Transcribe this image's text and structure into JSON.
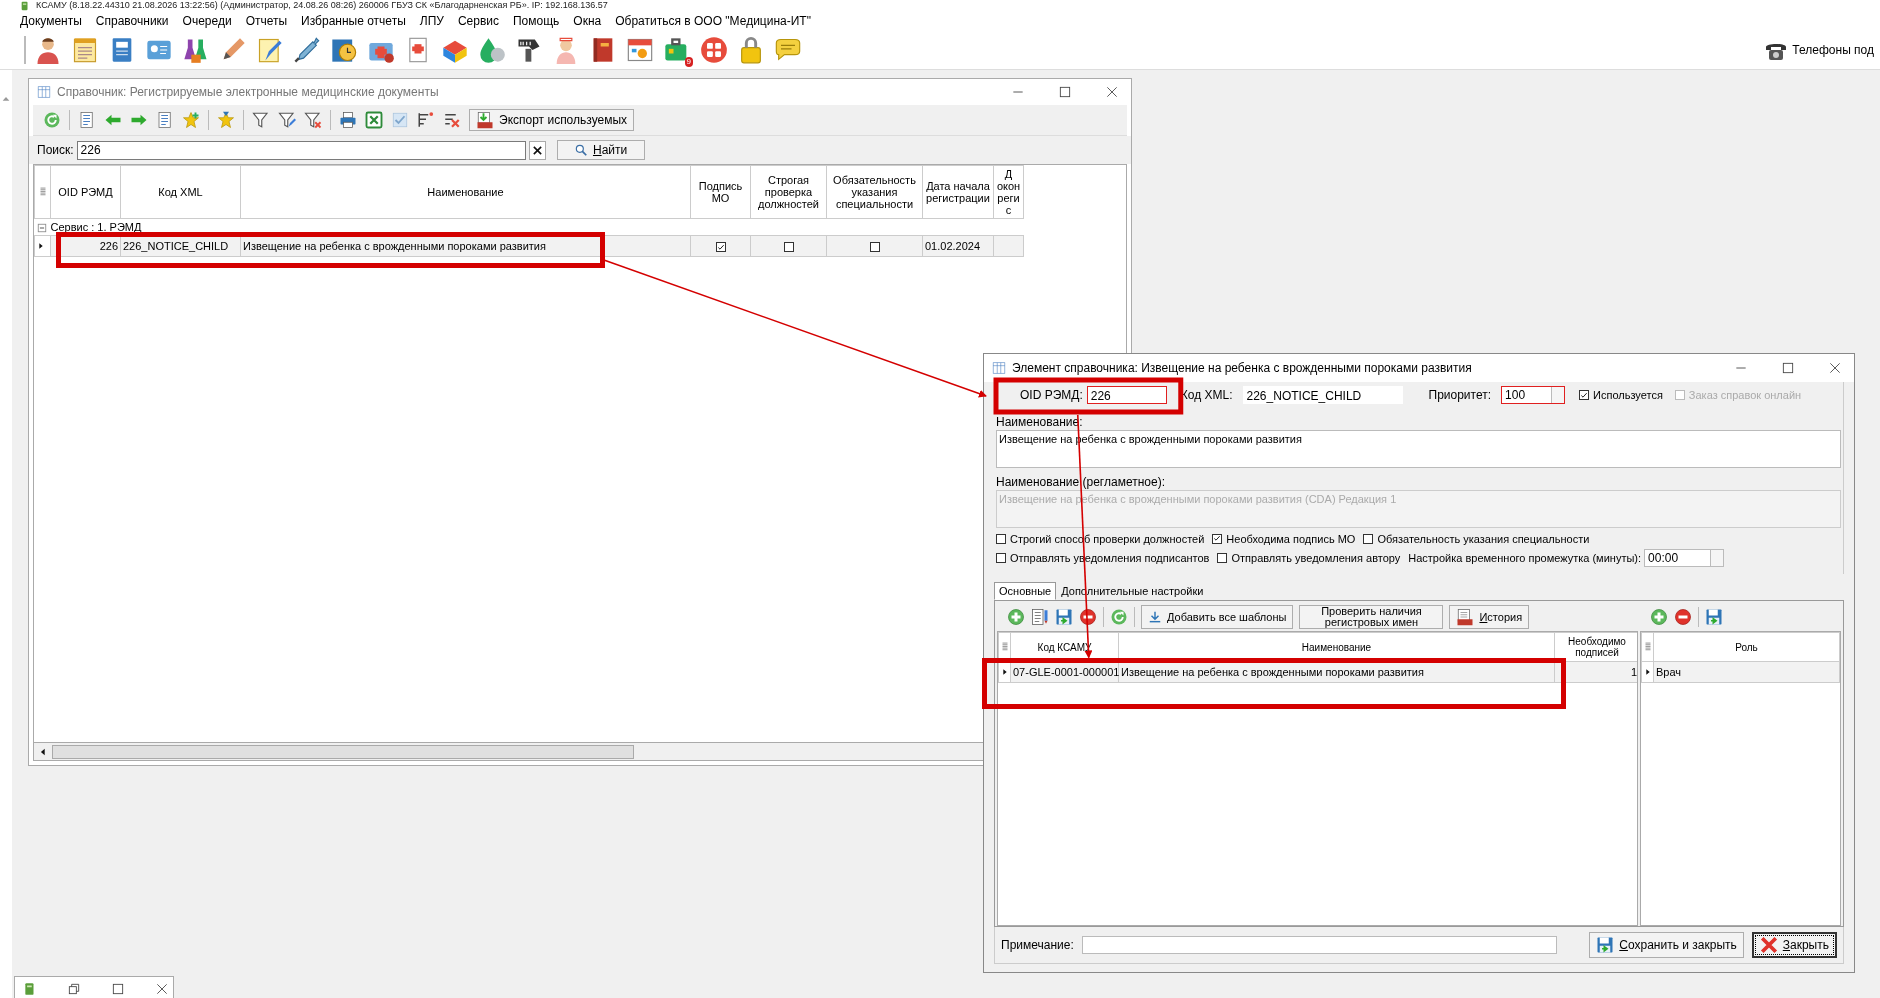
{
  "app_title": "КСАМУ (8.18.22.44310 21.08.2026 13:22:56) (Администратор, 24.08.26 08:26) 260006 ГБУЗ СК «Благодарненская РБ». IP: 192.168.136.57",
  "menu": [
    "Документы",
    "Справочники",
    "Очереди",
    "Отчеты",
    "Избранные отчеты",
    "ЛПУ",
    "Сервис",
    "Помощь",
    "Окна",
    "Обратиться в ООО \"Медицина-ИТ\""
  ],
  "toolbar": {
    "badge": "9",
    "phones_label": "Телефоны под"
  },
  "list_window": {
    "title": "Справочник: Регистрируемые электронные медицинские документы",
    "active": false,
    "export_button": "Экспорт используемых",
    "search": {
      "label": "Поиск:",
      "value": "226",
      "find_button": "Найти"
    },
    "table": {
      "columns": [
        "OID РЭМД",
        "Код XML",
        "Наименование",
        "Подпись МО",
        "Строгая проверка должностей",
        "Обязательность указания специальности",
        "Дата начала регистрации",
        "Д окон регис"
      ],
      "groups": [
        {
          "label": "Сервис : 1. РЭМД",
          "expanded": true,
          "rows": [
            {
              "oid": "226",
              "code": "226_NOTICE_CHILD",
              "name": "Извещение на ребенка с врожденными пороками развития",
              "signature_mo": true,
              "strict_check": false,
              "specialty_required": false,
              "start_date": "01.02.2024",
              "selected": true
            }
          ]
        }
      ]
    }
  },
  "dialog": {
    "title": "Элемент справочника: Извещение на ребенка с врожденными пороками развития",
    "oid": {
      "label": "OID РЭМД:",
      "value": "226",
      "invalid": true
    },
    "xml_code": {
      "label": "Код XML:",
      "value": "226_NOTICE_CHILD"
    },
    "priority": {
      "label": "Приоритет:",
      "value": "100",
      "invalid": true
    },
    "flags": [
      {
        "label": "Используется",
        "checked": true,
        "disabled": false
      },
      {
        "label": "Заказ справок онлайн",
        "checked": false,
        "disabled": true
      }
    ],
    "name": {
      "label": "Наименование:",
      "value": "Извещение на ребенка с врожденными пороками развития"
    },
    "reg_name": {
      "label": "Наименование (регламетное):",
      "value": "Извещение на ребенка с врожденными пороками развития (CDA) Редакция 1",
      "disabled": true
    },
    "options_rows": [
      [
        {
          "label": "Строгий способ проверки должностей",
          "checked": false
        },
        {
          "label": "Необходима подпись МО",
          "checked": true
        },
        {
          "label": "Обязательность указания специальности",
          "checked": false
        }
      ],
      [
        {
          "label": "Отправлять уведомления подписантов",
          "checked": false
        },
        {
          "label": "Отправлять уведомления автору",
          "checked": false
        }
      ]
    ],
    "interval": {
      "label": "Настройка временного промежутка (минуты):",
      "value": "00:00"
    },
    "tabs": [
      {
        "label": "Основные",
        "selected": true
      },
      {
        "label": "Дополнительные настройки",
        "selected": false
      }
    ],
    "template_buttons": [
      {
        "label": "Добавить все шаблоны",
        "kind": "download"
      },
      {
        "label": "Проверить наличия регистровых имен",
        "kind": "plain"
      },
      {
        "label": "История",
        "kind": "log"
      }
    ],
    "templates_table": {
      "columns": [
        "Код КСАМУ",
        "Наименование",
        "Необходимо подписей"
      ],
      "rows": [
        {
          "cells": [
            "07-GLE-0001-000001",
            "Извещение на ребенка с врожденными пороками развития",
            "1"
          ],
          "selected": true
        }
      ]
    },
    "roles_table": {
      "columns": [
        "Роль"
      ],
      "rows": [
        {
          "cells": [
            "Врач"
          ],
          "selected": true
        }
      ]
    },
    "note": {
      "label": "Примечание:"
    },
    "save_button": "Сохранить и закрыть",
    "close_button": "Закрыть"
  }
}
